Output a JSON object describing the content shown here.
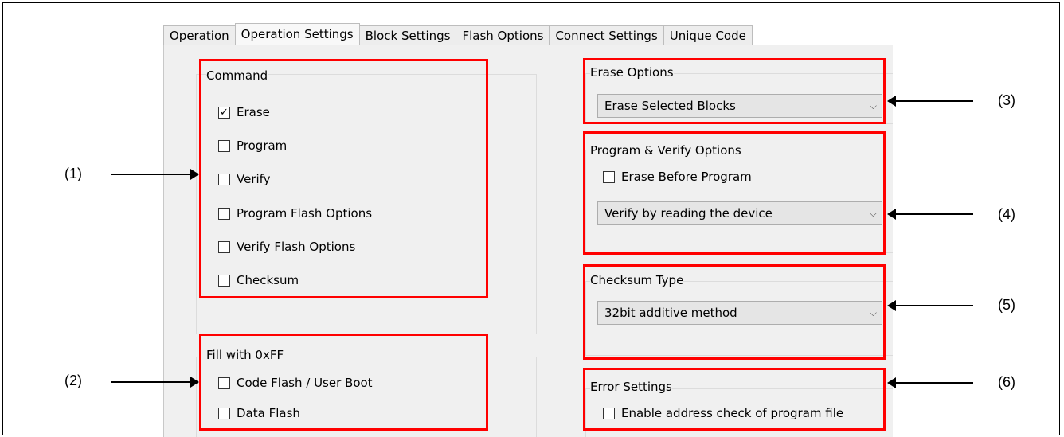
{
  "tabs": [
    "Operation",
    "Operation Settings",
    "Block Settings",
    "Flash Options",
    "Connect Settings",
    "Unique Code"
  ],
  "command": {
    "title": "Command",
    "items": [
      {
        "label": "Erase",
        "checked": true
      },
      {
        "label": "Program",
        "checked": false
      },
      {
        "label": "Verify",
        "checked": false
      },
      {
        "label": "Program Flash Options",
        "checked": false
      },
      {
        "label": "Verify Flash Options",
        "checked": false
      },
      {
        "label": "Checksum",
        "checked": false
      }
    ]
  },
  "fill": {
    "title": "Fill with 0xFF",
    "items": [
      {
        "label": "Code Flash / User Boot",
        "checked": false
      },
      {
        "label": "Data Flash",
        "checked": false
      }
    ]
  },
  "erase_options": {
    "title": "Erase Options",
    "value": "Erase Selected Blocks"
  },
  "program_verify": {
    "title": "Program & Verify Options",
    "erase_before": {
      "label": "Erase Before Program",
      "checked": false
    },
    "value": "Verify by reading the device"
  },
  "checksum_type": {
    "title": "Checksum Type",
    "value": "32bit additive method"
  },
  "error_settings": {
    "title": "Error Settings",
    "enable_check": {
      "label": "Enable address check of program file",
      "checked": false
    }
  },
  "callouts": [
    "(1)",
    "(2)",
    "(3)",
    "(4)",
    "(5)",
    "(6)"
  ],
  "highlight_color": "#ff0000",
  "check_glyph": "✓",
  "chevron_glyph": "⌵"
}
